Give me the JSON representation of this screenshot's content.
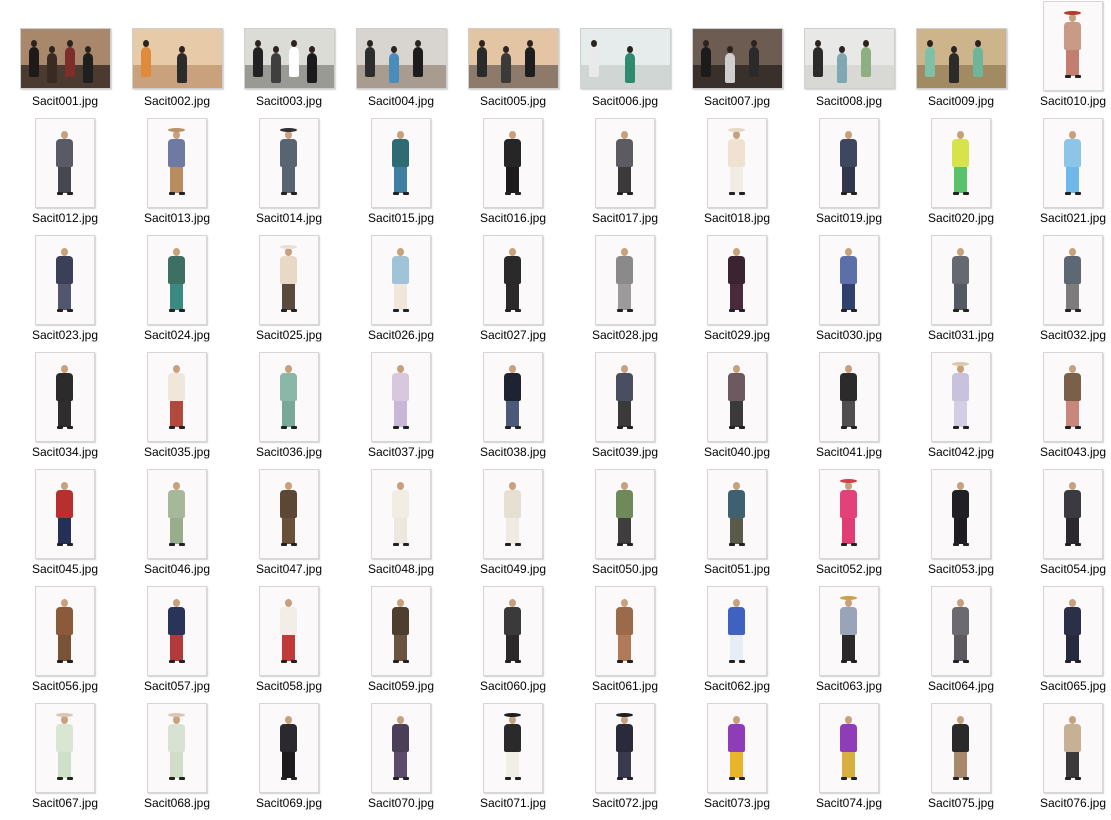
{
  "explorer": {
    "view": "Large icons",
    "files": [
      {
        "name": "Sacit001.jpg",
        "kind": "landscape",
        "scene": {
          "wall": "#a8876a",
          "ground": "#4a3a30",
          "people": [
            "#1d1a19",
            "#3a2a24",
            "#7d2e2a",
            "#1f1f1f"
          ]
        }
      },
      {
        "name": "Sacit002.jpg",
        "kind": "landscape",
        "scene": {
          "wall": "#e7caa8",
          "ground": "#c9a27d",
          "people": [
            "#e08a3c",
            "#2b2b2b"
          ]
        }
      },
      {
        "name": "Sacit003.jpg",
        "kind": "landscape",
        "scene": {
          "wall": "#dcdcd6",
          "ground": "#9a9a95",
          "people": [
            "#222222",
            "#3f3f3f",
            "#ffffff",
            "#1b1b1b"
          ]
        }
      },
      {
        "name": "Sacit004.jpg",
        "kind": "landscape",
        "scene": {
          "wall": "#d8d4cf",
          "ground": "#a89c90",
          "people": [
            "#2d2d2d",
            "#4a8dbd",
            "#1c1c1c"
          ]
        }
      },
      {
        "name": "Sacit005.jpg",
        "kind": "landscape",
        "scene": {
          "wall": "#e3c4a3",
          "ground": "#8d7a6a",
          "people": [
            "#2a2a2a",
            "#3a3a3a",
            "#1e1e1e"
          ]
        }
      },
      {
        "name": "Sacit006.jpg",
        "kind": "landscape",
        "scene": {
          "wall": "#e6ecec",
          "ground": "#cfd6d4",
          "people": [
            "#e9e9e9",
            "#2f8b6f"
          ]
        }
      },
      {
        "name": "Sacit007.jpg",
        "kind": "landscape",
        "scene": {
          "wall": "#6d5c52",
          "ground": "#3a302b",
          "people": [
            "#1b1b1b",
            "#cfcfcf",
            "#2a2a2a"
          ]
        }
      },
      {
        "name": "Sacit008.jpg",
        "kind": "landscape",
        "scene": {
          "wall": "#e8e8e6",
          "ground": "#d8d8d4",
          "people": [
            "#2b2b2b",
            "#7fa8b2",
            "#8fae82"
          ]
        }
      },
      {
        "name": "Sacit009.jpg",
        "kind": "landscape",
        "scene": {
          "wall": "#cdb48a",
          "ground": "#a28a63",
          "people": [
            "#7fc0a7",
            "#2b2b2b",
            "#6fb59a"
          ]
        }
      },
      {
        "name": "Sacit010.jpg",
        "kind": "portrait",
        "top": "#c99a86",
        "bottom": "#c27e6e",
        "hat": "#b43a2e"
      },
      {
        "name": "Sacit012.jpg",
        "kind": "portrait",
        "top": "#5a5a66",
        "bottom": "#47474f"
      },
      {
        "name": "Sacit013.jpg",
        "kind": "portrait",
        "top": "#6f7aa3",
        "bottom": "#b88c5f",
        "hat": "#b99267"
      },
      {
        "name": "Sacit014.jpg",
        "kind": "portrait",
        "top": "#586570",
        "bottom": "#586570",
        "hat": "#2f2f2f"
      },
      {
        "name": "Sacit015.jpg",
        "kind": "portrait",
        "top": "#2f6b72",
        "bottom": "#3f7fa1"
      },
      {
        "name": "Sacit016.jpg",
        "kind": "portrait",
        "top": "#262626",
        "bottom": "#1c1c1c"
      },
      {
        "name": "Sacit017.jpg",
        "kind": "portrait",
        "top": "#5b5b60",
        "bottom": "#3a3a3a"
      },
      {
        "name": "Sacit018.jpg",
        "kind": "portrait",
        "top": "#efe2d0",
        "bottom": "#f1ede5",
        "hat": "#e6d9c2"
      },
      {
        "name": "Sacit019.jpg",
        "kind": "portrait",
        "top": "#3f4660",
        "bottom": "#30364b"
      },
      {
        "name": "Sacit020.jpg",
        "kind": "portrait",
        "top": "#d6e34a",
        "bottom": "#59c26a"
      },
      {
        "name": "Sacit021.jpg",
        "kind": "portrait",
        "top": "#8dc5e8",
        "bottom": "#6fb8ea"
      },
      {
        "name": "Sacit023.jpg",
        "kind": "portrait",
        "top": "#3b3f57",
        "bottom": "#52566e"
      },
      {
        "name": "Sacit024.jpg",
        "kind": "portrait",
        "top": "#3d6f62",
        "bottom": "#3a8a82"
      },
      {
        "name": "Sacit025.jpg",
        "kind": "portrait",
        "top": "#e6dac7",
        "bottom": "#5a4a3c",
        "hat": "#e8e0d4"
      },
      {
        "name": "Sacit026.jpg",
        "kind": "portrait",
        "top": "#9fc4d8",
        "bottom": "#f0e7dc"
      },
      {
        "name": "Sacit027.jpg",
        "kind": "portrait",
        "top": "#2a2a2a",
        "bottom": "#2a2a2a"
      },
      {
        "name": "Sacit028.jpg",
        "kind": "portrait",
        "top": "#8a8a8a",
        "bottom": "#9b9b9b"
      },
      {
        "name": "Sacit029.jpg",
        "kind": "portrait",
        "top": "#3a2430",
        "bottom": "#4a2a3a"
      },
      {
        "name": "Sacit030.jpg",
        "kind": "portrait",
        "top": "#5c6fa8",
        "bottom": "#2f3f6e"
      },
      {
        "name": "Sacit031.jpg",
        "kind": "portrait",
        "top": "#666a70",
        "bottom": "#555a62"
      },
      {
        "name": "Sacit032.jpg",
        "kind": "portrait",
        "top": "#5d6872",
        "bottom": "#7c7c7c"
      },
      {
        "name": "Sacit034.jpg",
        "kind": "portrait",
        "top": "#2b2b2b",
        "bottom": "#2e2e2e"
      },
      {
        "name": "Sacit035.jpg",
        "kind": "portrait",
        "top": "#efe6dc",
        "bottom": "#b2493e"
      },
      {
        "name": "Sacit036.jpg",
        "kind": "portrait",
        "top": "#8ab7a8",
        "bottom": "#7aa898"
      },
      {
        "name": "Sacit037.jpg",
        "kind": "portrait",
        "top": "#d9c7de",
        "bottom": "#c7b7d8"
      },
      {
        "name": "Sacit038.jpg",
        "kind": "portrait",
        "top": "#1f2230",
        "bottom": "#4a5a78"
      },
      {
        "name": "Sacit039.jpg",
        "kind": "portrait",
        "top": "#4a4e5e",
        "bottom": "#3a3a3a"
      },
      {
        "name": "Sacit040.jpg",
        "kind": "portrait",
        "top": "#6d5a60",
        "bottom": "#3a3a3a"
      },
      {
        "name": "Sacit041.jpg",
        "kind": "portrait",
        "top": "#2b2b2b",
        "bottom": "#4f4f4f"
      },
      {
        "name": "Sacit042.jpg",
        "kind": "portrait",
        "top": "#c9c2de",
        "bottom": "#d3cde6",
        "hat": "#d8c9a8"
      },
      {
        "name": "Sacit043.jpg",
        "kind": "portrait",
        "top": "#7a6048",
        "bottom": "#c9867a"
      },
      {
        "name": "Sacit045.jpg",
        "kind": "portrait",
        "top": "#b73030",
        "bottom": "#253058"
      },
      {
        "name": "Sacit046.jpg",
        "kind": "portrait",
        "top": "#a6b79a",
        "bottom": "#98ad8c"
      },
      {
        "name": "Sacit047.jpg",
        "kind": "portrait",
        "top": "#5c4634",
        "bottom": "#6a5039"
      },
      {
        "name": "Sacit048.jpg",
        "kind": "portrait",
        "top": "#f2ede4",
        "bottom": "#eee7dd"
      },
      {
        "name": "Sacit049.jpg",
        "kind": "portrait",
        "top": "#e6e0d4",
        "bottom": "#f0ebe2"
      },
      {
        "name": "Sacit050.jpg",
        "kind": "portrait",
        "top": "#6f8a5a",
        "bottom": "#3e3e3e"
      },
      {
        "name": "Sacit051.jpg",
        "kind": "portrait",
        "top": "#3e6070",
        "bottom": "#5a5a48"
      },
      {
        "name": "Sacit052.jpg",
        "kind": "portrait",
        "top": "#e3417a",
        "bottom": "#e03c76",
        "hat": "#d1404a"
      },
      {
        "name": "Sacit053.jpg",
        "kind": "portrait",
        "top": "#1f1f24",
        "bottom": "#1d1d22"
      },
      {
        "name": "Sacit054.jpg",
        "kind": "portrait",
        "top": "#3a3a40",
        "bottom": "#2a2a2e"
      },
      {
        "name": "Sacit056.jpg",
        "kind": "portrait",
        "top": "#8a5a3a",
        "bottom": "#7a5236"
      },
      {
        "name": "Sacit057.jpg",
        "kind": "portrait",
        "top": "#2a3458",
        "bottom": "#b23a3a"
      },
      {
        "name": "Sacit058.jpg",
        "kind": "portrait",
        "top": "#f3ede8",
        "bottom": "#c13a3a"
      },
      {
        "name": "Sacit059.jpg",
        "kind": "portrait",
        "top": "#4e3e30",
        "bottom": "#6a5440"
      },
      {
        "name": "Sacit060.jpg",
        "kind": "portrait",
        "top": "#3a3a3a",
        "bottom": "#2a2a2a"
      },
      {
        "name": "Sacit061.jpg",
        "kind": "portrait",
        "top": "#9a6a4a",
        "bottom": "#b07a58"
      },
      {
        "name": "Sacit062.jpg",
        "kind": "portrait",
        "top": "#3f62c0",
        "bottom": "#e8ecf5"
      },
      {
        "name": "Sacit063.jpg",
        "kind": "portrait",
        "top": "#9aa4b8",
        "bottom": "#2a2a2a",
        "hat": "#c9a24a"
      },
      {
        "name": "Sacit064.jpg",
        "kind": "portrait",
        "top": "#6a6a70",
        "bottom": "#5a5a60"
      },
      {
        "name": "Sacit065.jpg",
        "kind": "portrait",
        "top": "#2b2f48",
        "bottom": "#252a3e"
      },
      {
        "name": "Sacit067.jpg",
        "kind": "portrait",
        "top": "#d9e6d4",
        "bottom": "#cfe0c8",
        "hat": "#d8c8b0"
      },
      {
        "name": "Sacit068.jpg",
        "kind": "portrait",
        "top": "#d9e2d2",
        "bottom": "#cfdcc6",
        "hat": "#d8c8b0"
      },
      {
        "name": "Sacit069.jpg",
        "kind": "portrait",
        "top": "#2a2a2e",
        "bottom": "#1c1c1e"
      },
      {
        "name": "Sacit070.jpg",
        "kind": "portrait",
        "top": "#4a3e58",
        "bottom": "#5a4c6a"
      },
      {
        "name": "Sacit071.jpg",
        "kind": "portrait",
        "top": "#2a2a2a",
        "bottom": "#f2eee8",
        "hat": "#1e1e1e"
      },
      {
        "name": "Sacit072.jpg",
        "kind": "portrait",
        "top": "#2a2a3a",
        "bottom": "#3a3a4e",
        "hat": "#1e1e1e"
      },
      {
        "name": "Sacit073.jpg",
        "kind": "portrait",
        "top": "#8e3cb8",
        "bottom": "#e8b42a"
      },
      {
        "name": "Sacit074.jpg",
        "kind": "portrait",
        "top": "#8e3cb8",
        "bottom": "#d8b040"
      },
      {
        "name": "Sacit075.jpg",
        "kind": "portrait",
        "top": "#2a2a2a",
        "bottom": "#a88a6a"
      },
      {
        "name": "Sacit076.jpg",
        "kind": "portrait",
        "top": "#c8b094",
        "bottom": "#3a3a3a"
      }
    ]
  }
}
